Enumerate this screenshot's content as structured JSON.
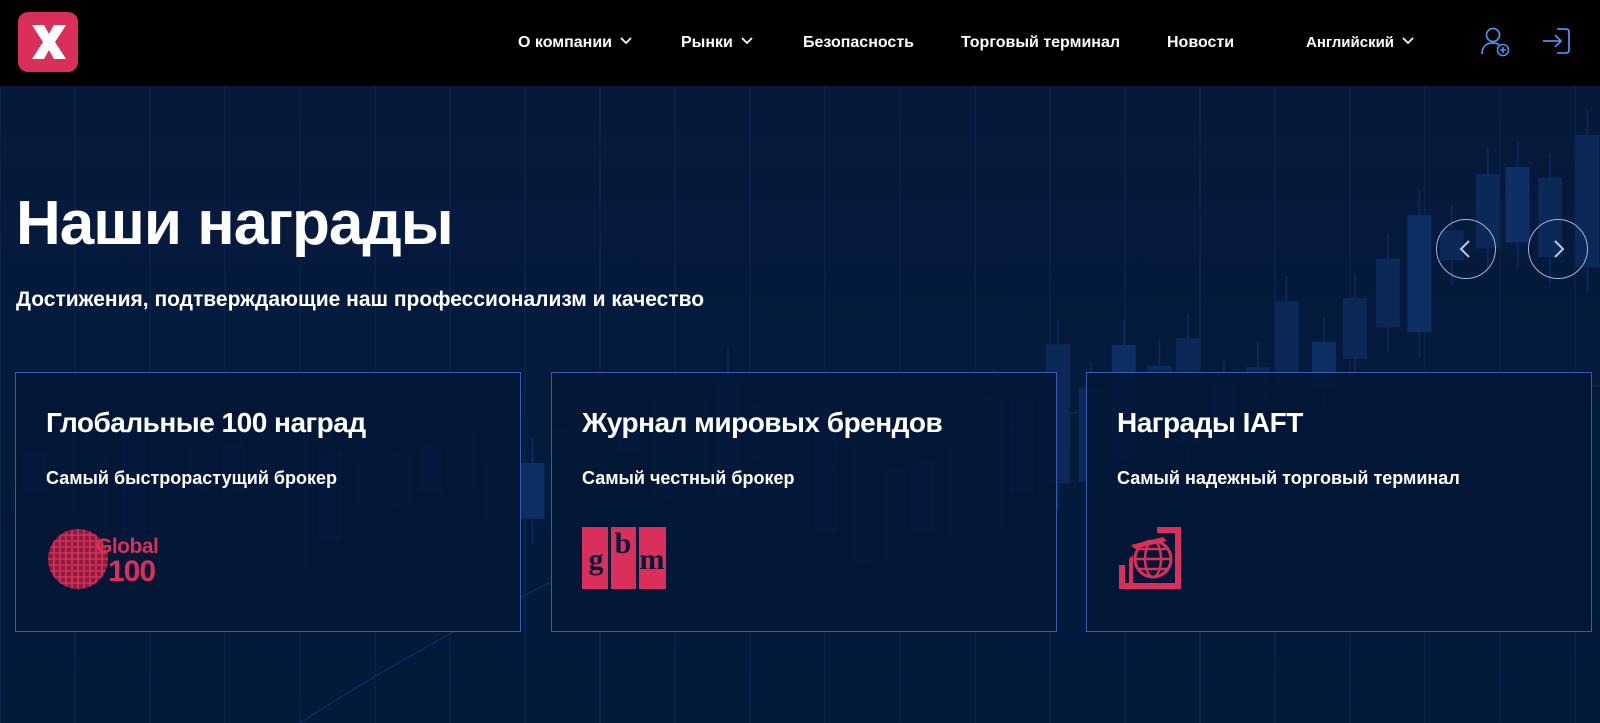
{
  "header": {
    "nav": [
      {
        "label": "О компании",
        "has_dropdown": true
      },
      {
        "label": "Рынки",
        "has_dropdown": true
      },
      {
        "label": "Безопасность",
        "has_dropdown": false
      },
      {
        "label": "Торговый терминал",
        "has_dropdown": false
      },
      {
        "label": "Новости",
        "has_dropdown": false
      }
    ],
    "language": "Английский",
    "icons": [
      "logo-x-icon",
      "user-add-icon",
      "login-arrow-icon",
      "chevron-down-icon"
    ]
  },
  "hero": {
    "title": "Наши награды",
    "subtitle": "Достижения, подтверждающие наш профессионализм и качество",
    "carousel_icons": [
      "arrow-left-icon",
      "arrow-right-icon"
    ]
  },
  "awards": [
    {
      "title": "Глобальные 100 наград",
      "subtitle": "Самый быстрорастущий брокер",
      "logo_icon": "global-100-logo-icon",
      "logo_text": [
        "Global",
        "100"
      ]
    },
    {
      "title": "Журнал мировых брендов",
      "subtitle": "Самый честный брокер",
      "logo_icon": "gbm-logo-icon",
      "logo_text": [
        "g",
        "b",
        "m"
      ]
    },
    {
      "title": "Награды IAFT",
      "subtitle": "Самый надежный торговый терминал",
      "logo_icon": "iaft-globe-logo-icon"
    }
  ],
  "colors": {
    "accent": "#d92f5a",
    "header_bg": "#000000",
    "page_bg": "#031a3b",
    "card_border": "#3a5ab0",
    "icon_blue": "#4a8fe8"
  }
}
